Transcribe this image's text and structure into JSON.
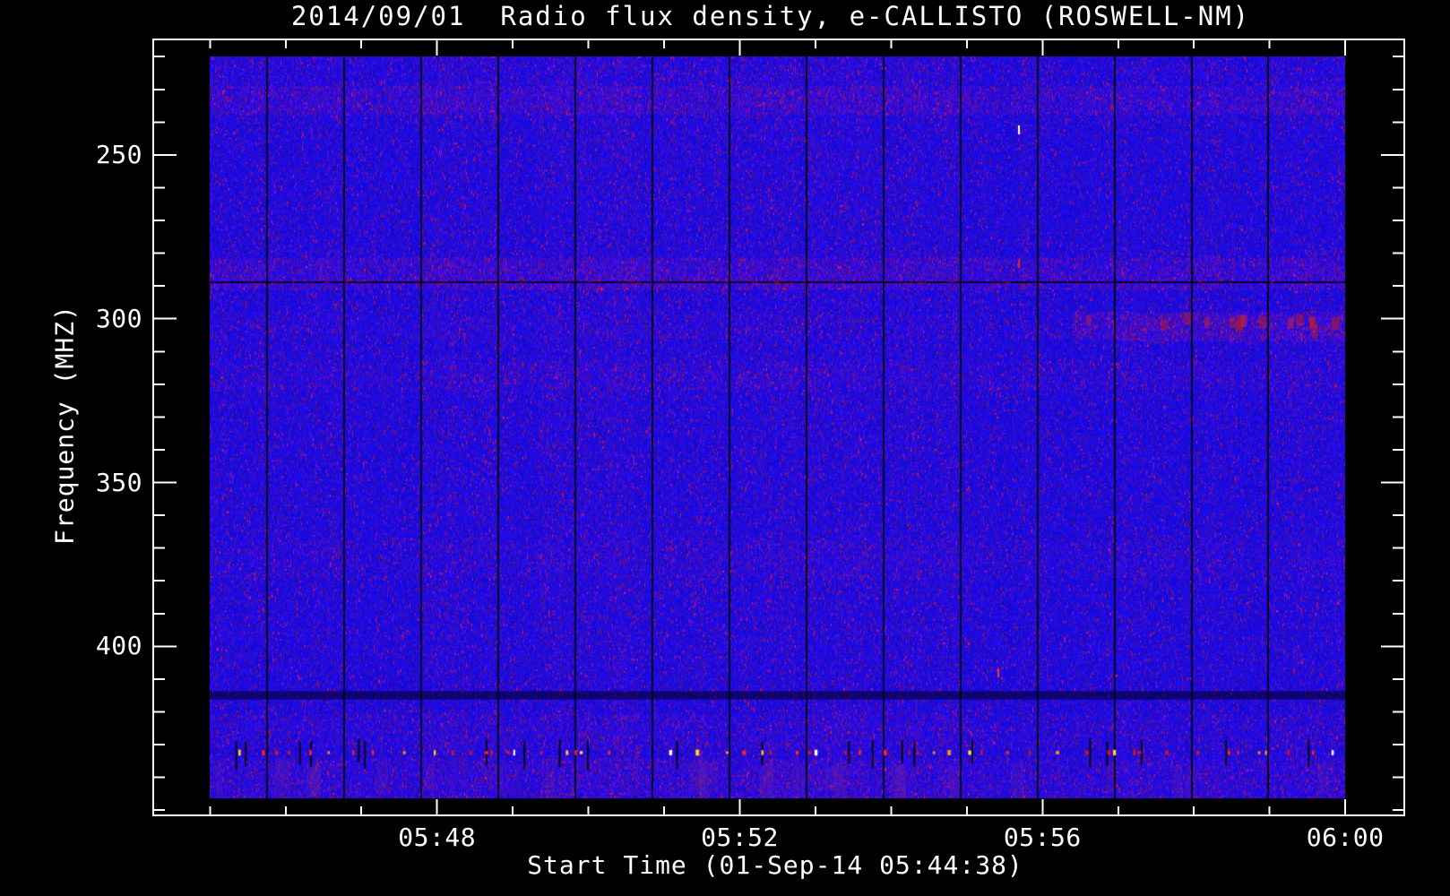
{
  "figure": {
    "title": "2014/09/01  Radio flux density, e-CALLISTO (ROSWELL-NM)",
    "background_color": "#000000",
    "text_color": "#ffffff",
    "frame_color": "#ffffff"
  },
  "chart_data": {
    "type": "heatmap",
    "title": "2014/09/01  Radio flux density, e-CALLISTO (ROSWELL-NM)",
    "xlabel": "Start Time (01-Sep-14 05:44:38)",
    "ylabel": "Frequency (MHZ)",
    "date": "2014/09/01",
    "start_time": "01-Sep-14 05:44:38",
    "instrument": "e-CALLISTO",
    "station": "ROSWELL-NM",
    "x_axis": {
      "unit": "hh:mm",
      "min_minutes": 44.25,
      "max_minutes": 60.78,
      "major_ticks": [
        {
          "label": "05:48",
          "minutes": 48
        },
        {
          "label": "05:52",
          "minutes": 52
        },
        {
          "label": "05:56",
          "minutes": 56
        },
        {
          "label": "06:00",
          "minutes": 60
        }
      ],
      "minor_tick_minutes": [
        45,
        46,
        47,
        49,
        50,
        51,
        53,
        54,
        55,
        57,
        58,
        59
      ]
    },
    "y_axis": {
      "unit": "MHz",
      "min_mhz": 214.75,
      "max_mhz": 451.6,
      "increases_downward": true,
      "major_ticks": [
        {
          "label": "250",
          "mhz": 250
        },
        {
          "label": "300",
          "mhz": 300
        },
        {
          "label": "350",
          "mhz": 350
        },
        {
          "label": "400",
          "mhz": 400
        }
      ],
      "minor_tick_mhz": [
        220,
        230,
        240,
        260,
        270,
        280,
        290,
        310,
        320,
        330,
        340,
        360,
        370,
        380,
        390,
        410,
        420,
        430,
        440,
        450
      ]
    },
    "image": {
      "time_min_minutes": 45.0,
      "time_max_minutes": 60.0,
      "mhz_min": 220.0,
      "mhz_max": 446.4,
      "base_color": "#2012e6",
      "palette": {
        "blue": "#2012e6",
        "purple": "#5a28b0",
        "dark_red": "#8c1440",
        "bright_red": "#ff2418"
      }
    },
    "features": {
      "segment_gap_lines": {
        "first_minute": 45.74,
        "step_minutes": 1.018,
        "count": 15,
        "color": "#000010"
      },
      "rfi_bands_mhz": [
        {
          "mhz0": 220.0,
          "mhz1": 229.0,
          "intensity": 1.15
        },
        {
          "mhz0": 229.0,
          "mhz1": 237.5,
          "intensity": 1.8
        },
        {
          "mhz0": 281.0,
          "mhz1": 291.0,
          "intensity": 1.9
        },
        {
          "mhz0": 298.5,
          "mhz1": 306.0,
          "intensity": 1.2
        },
        {
          "mhz0": 313.0,
          "mhz1": 321.5,
          "intensity": 1.35
        },
        {
          "mhz0": 367.0,
          "mhz1": 379.0,
          "intensity": 1.25
        },
        {
          "mhz0": 420.5,
          "mhz1": 431.0,
          "intensity": 1.3
        },
        {
          "mhz0": 434.0,
          "mhz1": 446.4,
          "intensity": 1.5
        }
      ],
      "dark_line_mhz": 288.5,
      "dark_band_mhz": {
        "mhz0": 413.5,
        "mhz1": 416.2
      },
      "hot_patch": {
        "minute0": 56.4,
        "minute1": 60.0,
        "mhz0": 298.0,
        "mhz1": 306.5,
        "intensity": 2.2
      },
      "speckle_row": {
        "mhz": 432.5,
        "colors": [
          "#ff2418",
          "#c01830",
          "#ff8c1e",
          "#ffd23c",
          "#ffffff"
        ],
        "black_stroke_mhz0": 428.0,
        "black_stroke_mhz1": 437.0
      },
      "smudges_mhz": {
        "mhz0": 435.0,
        "mhz1": 446.0,
        "color": "rgba(130,40,150,0.18)"
      },
      "point_artifacts": [
        {
          "minute": 55.69,
          "mhz": 242.3,
          "color": "#ffffff"
        },
        {
          "minute": 55.69,
          "mhz": 283.0,
          "color": "#d02446"
        },
        {
          "minute": 55.42,
          "mhz": 408.0,
          "color": "#ff3030"
        }
      ]
    }
  }
}
